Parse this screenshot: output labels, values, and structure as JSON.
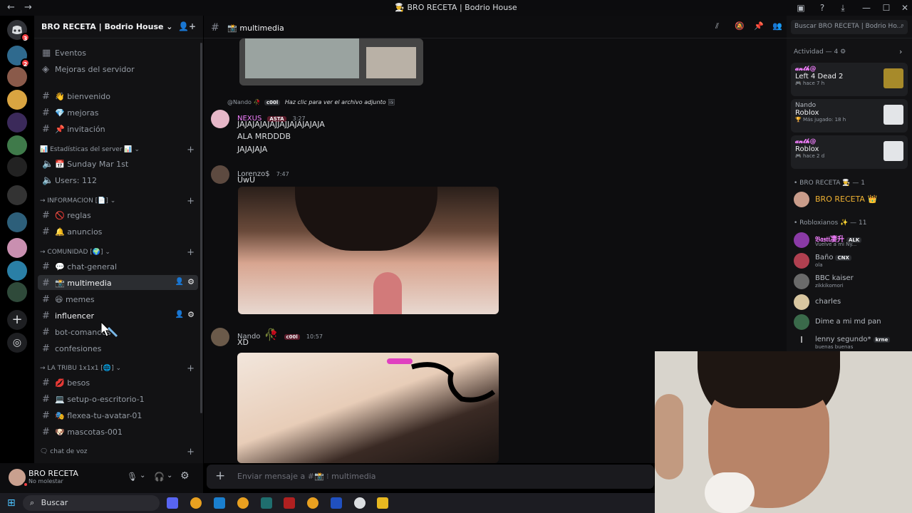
{
  "window": {
    "title": "BRO RECETA | Bodrio House",
    "title_emoji": "👨‍🍳"
  },
  "guilds": {
    "badge_top": "3",
    "badge_second": "2"
  },
  "server": {
    "name": "BRO RECETA | Bodrio House",
    "items": [
      {
        "label": "Eventos",
        "icon": "calendar-icon"
      },
      {
        "label": "Mejoras del servidor",
        "icon": "boost-icon"
      }
    ],
    "channels_top": [
      {
        "label": "👋 bienvenido"
      },
      {
        "label": "💎 mejoras"
      },
      {
        "label": "📌 invitación"
      }
    ],
    "cat_stats": "📊 Estadísticas del server 📊",
    "stats": [
      {
        "label": "📅 Sunday Mar 1st"
      },
      {
        "label": "Users: 112"
      }
    ],
    "cat_info": "INFORMACION [📄]",
    "info": [
      {
        "label": "🚫 reglas"
      },
      {
        "label": "🔔 anuncios"
      }
    ],
    "cat_comunidad": "COMUNIDAD [🌍]",
    "comunidad": [
      {
        "label": "💬 chat-general"
      },
      {
        "label": "📸 multimedia"
      },
      {
        "label": "😆 memes"
      },
      {
        "label": "influencer"
      },
      {
        "label": "bot-comandos"
      },
      {
        "label": "confesiones"
      }
    ],
    "cat_tribu": "LA TRIBU 1x1x1 [🌐]",
    "tribu": [
      {
        "label": "💋 besos"
      },
      {
        "label": "💻 setup-o-escritorio-1"
      },
      {
        "label": "🎭 flexea-tu-avatar-01"
      },
      {
        "label": "🐶 mascotas-001"
      }
    ],
    "cat_voz": "chat de voz"
  },
  "user": {
    "name": "BRO RECETA",
    "status": "No molestar"
  },
  "chat": {
    "channel": "📸 multimedia",
    "search_placeholder": "Buscar BRO RECETA | Bodrio Ho...",
    "reply_author": "@Nando",
    "reply_tag": "c00l",
    "reply_text": "Haz clic para ver el archivo adjunto",
    "messages": [
      {
        "author": "NEXUS",
        "tag": "ASTA",
        "time": "3:27",
        "lines": [
          "JAJAJAJAJAJJAJJAJAJAJAJA",
          "ALA MRDDDB",
          "JAJAJAJA"
        ],
        "color": "#f47fff"
      },
      {
        "author": "Lorenzo$",
        "time": "7:47",
        "lines": [
          "UwU"
        ],
        "color": "#b5bac1"
      },
      {
        "author": "Nando",
        "tag": "c00l",
        "time": "10:57",
        "lines": [
          "XD"
        ],
        "color": "#b5bac1"
      }
    ],
    "composer_placeholder": "Enviar mensaje a #📸 ⁝ multimedia"
  },
  "members": {
    "activity_header": "Actividad — 4",
    "activities": [
      {
        "name": "𝓪𝓷𝓽𝓱@",
        "game": "Left 4 Dead 2",
        "detail": "hace 7 h",
        "name_color": "#f47fff"
      },
      {
        "name": "Nando",
        "game": "Roblox",
        "detail": "Más jugado: 18 h",
        "name_color": "#b5bac1"
      },
      {
        "name": "𝓪𝓷𝓽𝓱@",
        "game": "Roblox",
        "detail": "hace 2 d",
        "name_color": "#f47fff"
      }
    ],
    "group1": "• BRO RECETA 👨‍🍳 — 1",
    "group1_members": [
      {
        "name": "BRO RECETA 👑",
        "status": "",
        "color": "#f0b232"
      }
    ],
    "group2": "• Robloxianos ✨ — 11",
    "group2_members": [
      {
        "name": "𝔅𝔞𝔰𝔱𝔦凄升",
        "tag": "ALK",
        "status": "Vuelve a mi Ny...",
        "color": "#f47fff"
      },
      {
        "name": "Baño",
        "tag": "CNX",
        "status": "ola",
        "color": "#b5bac1"
      },
      {
        "name": "BBC kaiser",
        "status": "zikkikomori",
        "color": "#b5bac1"
      },
      {
        "name": "charles",
        "status": "",
        "color": "#b5bac1"
      },
      {
        "name": "Dime a mi md pan",
        "status": "",
        "color": "#b5bac1"
      },
      {
        "name": "lenny segundo*",
        "tag": "krne",
        "status": "buenas buenas",
        "color": "#b5bac1"
      }
    ]
  },
  "taskbar": {
    "search": "Buscar"
  }
}
